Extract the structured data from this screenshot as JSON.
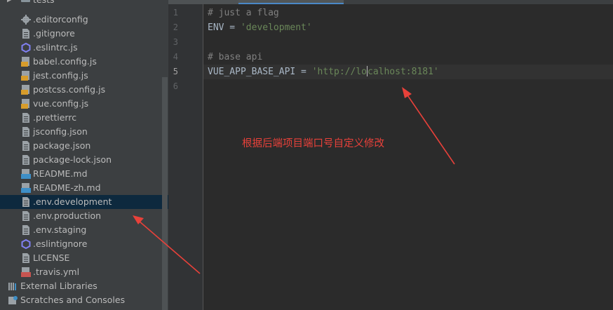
{
  "project_tree": {
    "top_partial": "tests",
    "items": [
      {
        "label": ".editorconfig",
        "icon": "gear-icon"
      },
      {
        "label": ".gitignore",
        "icon": "text-file-icon"
      },
      {
        "label": ".eslintrc.js",
        "icon": "eslint-icon"
      },
      {
        "label": "babel.config.js",
        "icon": "js-file-icon"
      },
      {
        "label": "jest.config.js",
        "icon": "js-file-icon"
      },
      {
        "label": "postcss.config.js",
        "icon": "js-file-icon"
      },
      {
        "label": "vue.config.js",
        "icon": "js-file-icon"
      },
      {
        "label": ".prettierrc",
        "icon": "text-file-icon"
      },
      {
        "label": "jsconfig.json",
        "icon": "text-file-icon"
      },
      {
        "label": "package.json",
        "icon": "text-file-icon"
      },
      {
        "label": "package-lock.json",
        "icon": "text-file-icon"
      },
      {
        "label": "README.md",
        "icon": "markdown-icon"
      },
      {
        "label": "README-zh.md",
        "icon": "markdown-icon"
      },
      {
        "label": ".env.development",
        "icon": "text-file-icon",
        "selected": true
      },
      {
        "label": ".env.production",
        "icon": "text-file-icon"
      },
      {
        "label": ".env.staging",
        "icon": "text-file-icon"
      },
      {
        "label": ".eslintignore",
        "icon": "eslint-icon"
      },
      {
        "label": "LICENSE",
        "icon": "text-file-icon"
      },
      {
        "label": ".travis.yml",
        "icon": "yml-file-icon"
      }
    ],
    "external_libraries": "External Libraries",
    "scratches": "Scratches and Consoles"
  },
  "editor": {
    "line_numbers": [
      "1",
      "2",
      "3",
      "4",
      "5",
      "6"
    ],
    "current_line": "5",
    "lines": [
      {
        "text": "# just a flag",
        "type": "comment"
      },
      {
        "text": "ENV = 'development'",
        "type": "code"
      },
      {
        "text": "",
        "type": "blank"
      },
      {
        "text": "# base api",
        "type": "comment"
      },
      {
        "text": "VUE_APP_BASE_API = 'http://localhost:8181'",
        "type": "code"
      },
      {
        "text": "",
        "type": "blank"
      }
    ]
  },
  "annotation": {
    "text": "根据后端项目端口号自定义修改",
    "color": "#e8413a"
  },
  "colors": {
    "sidebar_bg": "#3c3f41",
    "editor_bg": "#2b2b2b",
    "selection": "#0d293e",
    "comment": "#808080",
    "code": "#a9b7c6",
    "string": "#6a8759",
    "arrow": "#e8413a"
  }
}
